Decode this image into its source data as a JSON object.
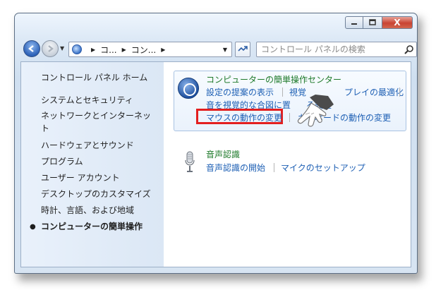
{
  "window": {
    "min_icon": "minimize-icon",
    "max_icon": "maximize-icon",
    "close_label": "X"
  },
  "nav": {
    "address_segments": [
      "コ...",
      "コン...",
      ""
    ],
    "search_placeholder": "コントロール パネルの検索"
  },
  "sidebar": {
    "home": "コントロール パネル ホーム",
    "items": [
      "システムとセキュリティ",
      "ネットワークとインターネッ",
      "ト",
      "ハードウェアとサウンド",
      "プログラム",
      "ユーザー アカウント",
      "デスクトップのカスタマイズ",
      "時計、言語、および地域",
      "コンピューターの簡単操作"
    ]
  },
  "ease": {
    "title": "コンピューターの簡単操作センター",
    "links": [
      "設定の提案の表示",
      "視覚",
      "プレイの最適化",
      "音を視覚的な合図に置",
      "る設定",
      "マウスの動作の変更",
      "キーボードの動作の変更"
    ]
  },
  "speech": {
    "title": "音声認識",
    "links": [
      "音声認識の開始",
      "マイクのセットアップ"
    ]
  },
  "colors": {
    "link": "#1d5fb4",
    "heading": "#1e7a2a",
    "highlight": "#e31f1f"
  }
}
